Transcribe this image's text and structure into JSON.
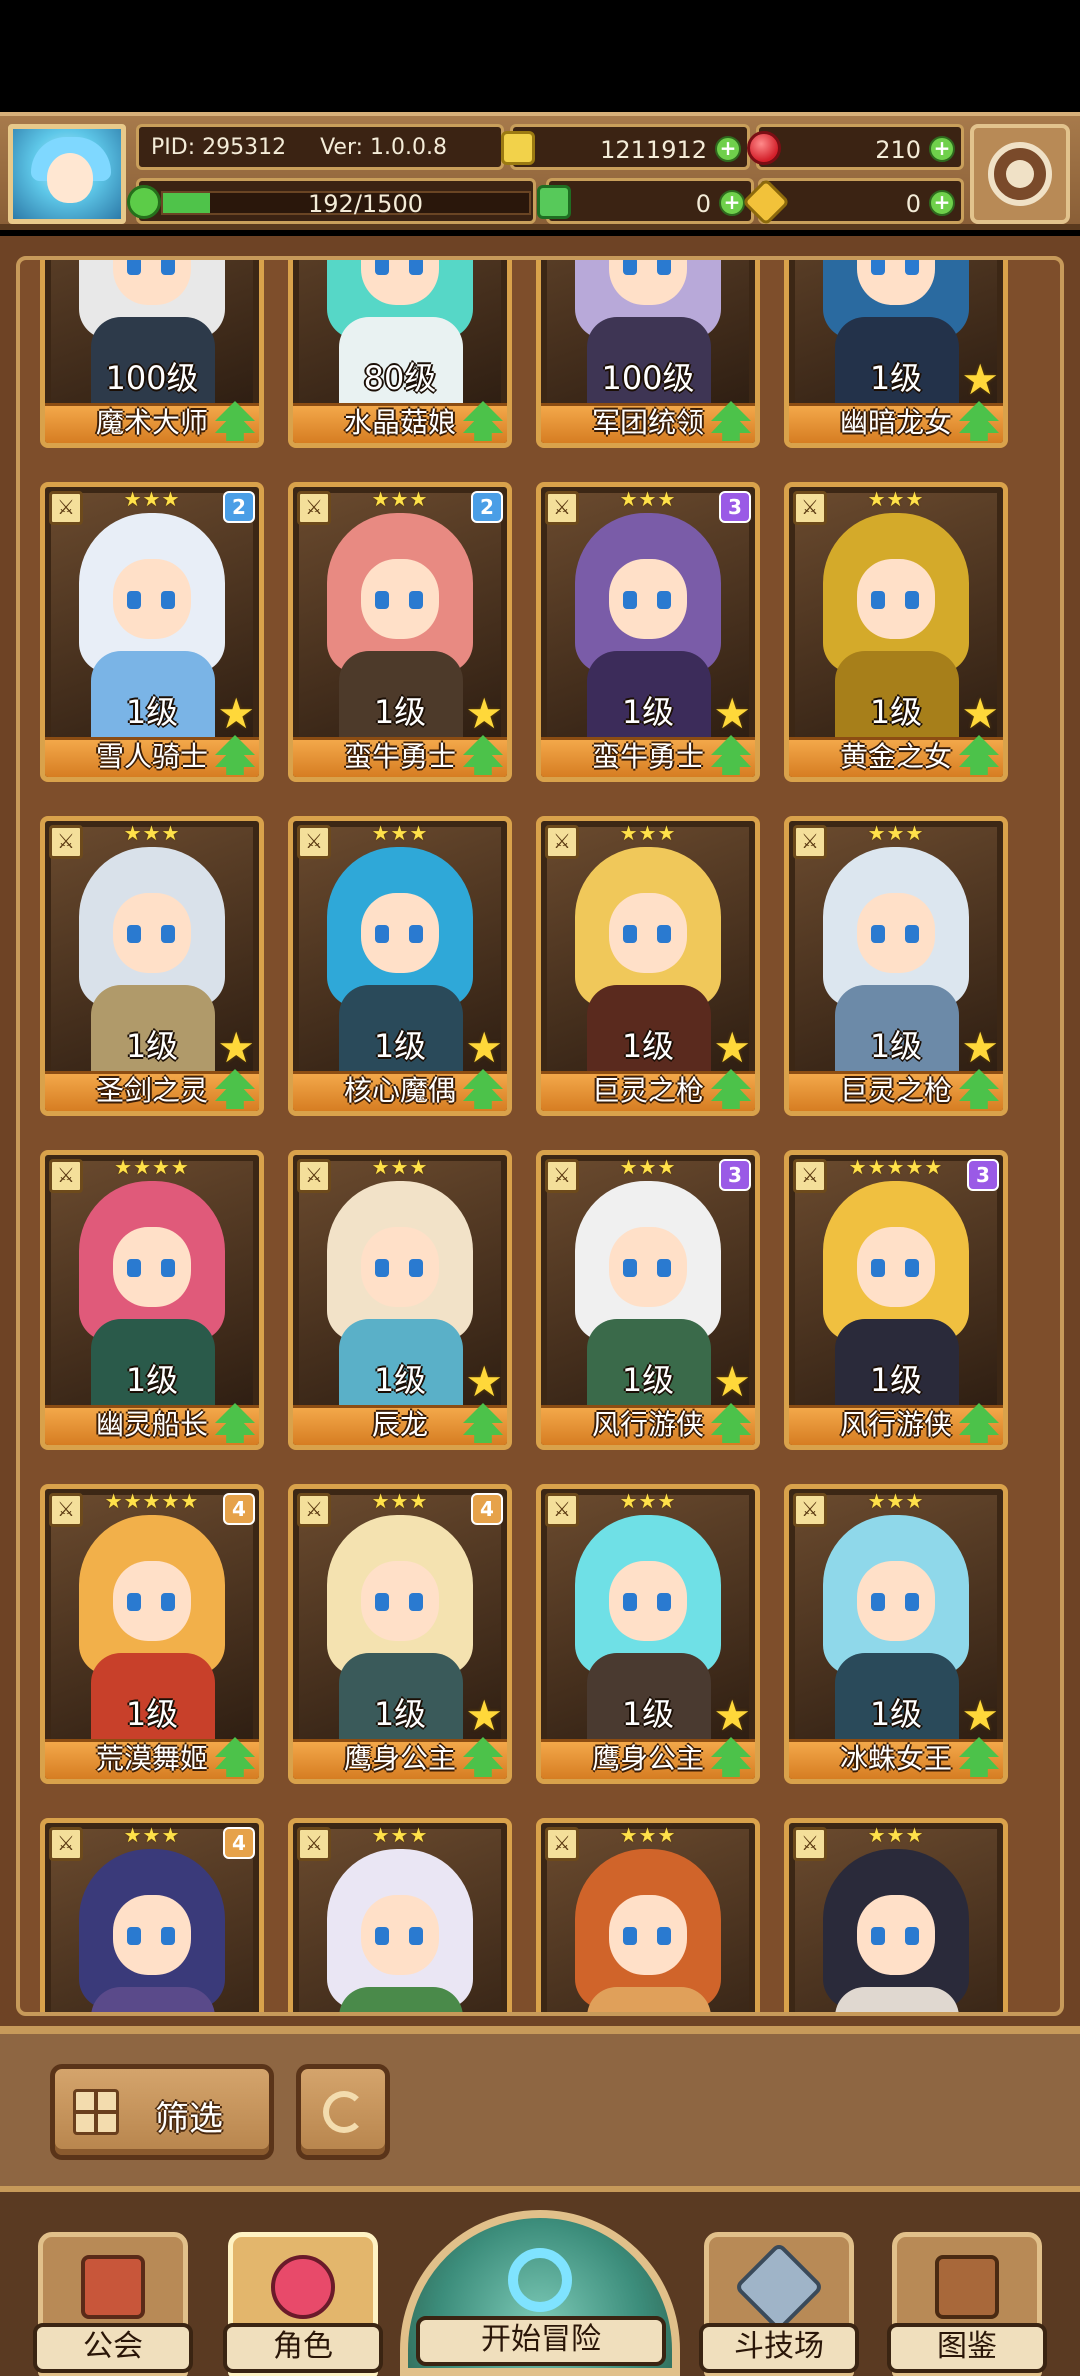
{
  "header": {
    "pid": "PID: 295312",
    "version": "Ver: 1.0.0.8",
    "gold": "1211912",
    "gems": "210",
    "energy": "192/1500",
    "energy_progress": 0.128,
    "currency_3": "0",
    "currency_4": "0"
  },
  "cards": [
    {
      "level": "100级",
      "name": "魔术大师",
      "stars": "",
      "rank": "",
      "hair": "#e8e8e8",
      "body": "#2d3a4a",
      "badge_star": false
    },
    {
      "level": "80级",
      "name": "水晶菇娘",
      "stars": "",
      "rank": "",
      "hair": "#56d7c7",
      "body": "#e9f2f2",
      "badge_star": false
    },
    {
      "level": "100级",
      "name": "军团统领",
      "stars": "",
      "rank": "",
      "hair": "#b8a9d9",
      "body": "#3e3554",
      "badge_star": false
    },
    {
      "level": "1级",
      "name": "幽暗龙女",
      "stars": "",
      "rank": "",
      "hair": "#2a6aa0",
      "body": "#23324a",
      "badge_star": true
    },
    {
      "level": "1级",
      "name": "雪人骑士",
      "stars": "★★★",
      "rank": "2",
      "rank_color": "b",
      "hair": "#e8eef7",
      "body": "#7ab4e6",
      "badge_star": true
    },
    {
      "level": "1级",
      "name": "蛮牛勇士",
      "stars": "★★★",
      "rank": "2",
      "rank_color": "b",
      "hair": "#e88a82",
      "body": "#4d3a2a",
      "badge_star": true
    },
    {
      "level": "1级",
      "name": "蛮牛勇士",
      "stars": "★★★",
      "rank": "3",
      "rank_color": "p",
      "hair": "#7a5ca8",
      "body": "#3c2c5a",
      "badge_star": true
    },
    {
      "level": "1级",
      "name": "黄金之女",
      "stars": "★★★",
      "rank": "",
      "hair": "#d4aa2a",
      "body": "#a77f1a",
      "badge_star": true
    },
    {
      "level": "1级",
      "name": "圣剑之灵",
      "stars": "★★★",
      "rank": "",
      "hair": "#d9e1ea",
      "body": "#b09a6a",
      "badge_star": true
    },
    {
      "level": "1级",
      "name": "核心魔偶",
      "stars": "★★★",
      "rank": "",
      "hair": "#2fa8d8",
      "body": "#2a4a5a",
      "badge_star": true
    },
    {
      "level": "1级",
      "name": "巨灵之枪",
      "stars": "★★★",
      "rank": "",
      "hair": "#f0c85a",
      "body": "#5a2a1e",
      "badge_star": true
    },
    {
      "level": "1级",
      "name": "巨灵之枪",
      "stars": "★★★",
      "rank": "",
      "hair": "#dce6ef",
      "body": "#6c8aa8",
      "badge_star": true
    },
    {
      "level": "1级",
      "name": "幽灵船长",
      "stars": "★★★★",
      "rank": "",
      "hair": "#e05a7a",
      "body": "#2a5a4a",
      "badge_star": false
    },
    {
      "level": "1级",
      "name": "辰龙",
      "stars": "★★★",
      "rank": "",
      "hair": "#f2e2c8",
      "body": "#5ab0c8",
      "badge_star": true
    },
    {
      "level": "1级",
      "name": "风行游侠",
      "stars": "★★★",
      "rank": "3",
      "rank_color": "p",
      "hair": "#f0f0f0",
      "body": "#3a6a4a",
      "badge_star": true
    },
    {
      "level": "1级",
      "name": "风行游侠",
      "stars": "★★★★★",
      "rank": "3",
      "rank_color": "p",
      "hair": "#f0c040",
      "body": "#2a2a3a",
      "badge_star": false
    },
    {
      "level": "1级",
      "name": "荒漠舞姬",
      "stars": "★★★★★",
      "rank": "4",
      "rank_color": "o",
      "hair": "#f2b04a",
      "body": "#c8402a",
      "badge_star": false
    },
    {
      "level": "1级",
      "name": "鹰身公主",
      "stars": "★★★",
      "rank": "4",
      "rank_color": "o",
      "hair": "#f4e2b0",
      "body": "#3a5a5a",
      "badge_star": true
    },
    {
      "level": "1级",
      "name": "鹰身公主",
      "stars": "★★★",
      "rank": "",
      "hair": "#6fe0e6",
      "body": "#4a3a30",
      "badge_star": true
    },
    {
      "level": "1级",
      "name": "冰蛛女王",
      "stars": "★★★",
      "rank": "",
      "hair": "#8fd8ea",
      "body": "#2a4a5a",
      "badge_star": true
    },
    {
      "level": "",
      "name": "",
      "stars": "★★★",
      "rank": "4",
      "rank_color": "o",
      "hair": "#3a3a7a",
      "body": "#5a4a8a",
      "badge_star": false
    },
    {
      "level": "",
      "name": "",
      "stars": "★★★",
      "rank": "",
      "hair": "#eae6f4",
      "body": "#4a8a4a",
      "badge_star": false
    },
    {
      "level": "",
      "name": "",
      "stars": "★★★",
      "rank": "",
      "hair": "#d0642a",
      "body": "#e0a05a",
      "badge_star": false
    },
    {
      "level": "",
      "name": "",
      "stars": "★★★",
      "rank": "",
      "hair": "#2a2a3a",
      "body": "#e0d8d0",
      "badge_star": false
    }
  ],
  "toolbar": {
    "filter_label": "筛选"
  },
  "nav": {
    "guild": "公会",
    "character": "角色",
    "adventure": "开始冒险",
    "arena": "斗技场",
    "codex": "图鉴"
  }
}
